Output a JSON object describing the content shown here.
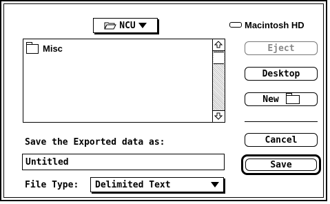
{
  "folder": {
    "name": "NCU"
  },
  "volume": {
    "name": "Macintosh HD"
  },
  "file_list": {
    "items": [
      {
        "name": "Misc"
      }
    ]
  },
  "buttons": {
    "eject": "Eject",
    "desktop": "Desktop",
    "new": "New",
    "cancel": "Cancel",
    "save": "Save"
  },
  "save_prompt": "Save the Exported data as:",
  "filename": {
    "value": "Untitled"
  },
  "file_type": {
    "label": "File Type:",
    "selected": "Delimited Text"
  },
  "icons": {
    "folder_popup": "open-folder-icon",
    "volume": "hard-disk-icon",
    "list_item": "folder-icon",
    "new": "new-folder-icon"
  }
}
